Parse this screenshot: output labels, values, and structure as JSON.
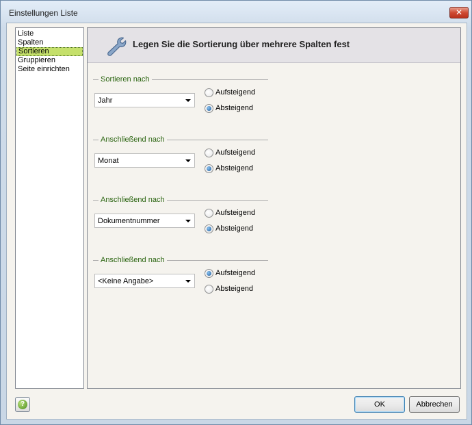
{
  "window": {
    "title": "Einstellungen Liste",
    "close_glyph": "✕"
  },
  "nav": {
    "items": [
      "Liste",
      "Spalten",
      "Sortieren",
      "Gruppieren",
      "Seite einrichten"
    ],
    "selected_index": 2
  },
  "header": {
    "icon": "wrench-icon",
    "title": "Legen Sie die Sortierung über mehrere Spalten fest"
  },
  "sort_groups": [
    {
      "label": "Sortieren nach",
      "value": "Jahr",
      "options": [
        "Aufsteigend",
        "Absteigend"
      ],
      "selected": "Absteigend"
    },
    {
      "label": "Anschließend nach",
      "value": "Monat",
      "options": [
        "Aufsteigend",
        "Absteigend"
      ],
      "selected": "Absteigend"
    },
    {
      "label": "Anschließend nach",
      "value": "Dokumentnummer",
      "options": [
        "Aufsteigend",
        "Absteigend"
      ],
      "selected": "Absteigend"
    },
    {
      "label": "Anschließend nach",
      "value": "<Keine Angabe>",
      "options": [
        "Aufsteigend",
        "Absteigend"
      ],
      "selected": "Aufsteigend"
    }
  ],
  "footer": {
    "help_glyph": "?",
    "ok_label": "OK",
    "cancel_label": "Abbrechen"
  },
  "colors": {
    "nav_selected": "#c5e06b",
    "group_label": "#2a6410",
    "panel_background": "#f5f3ee",
    "header_background": "#e4e2e6"
  }
}
